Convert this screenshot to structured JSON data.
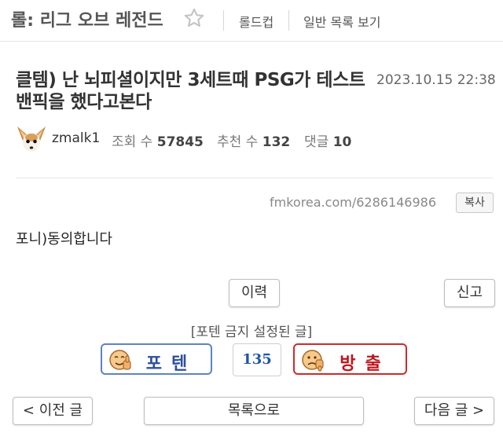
{
  "header": {
    "board_title": "롤: 리그 오브 레전드",
    "links": [
      "롤드컵",
      "일반 목록 보기"
    ]
  },
  "post": {
    "title": "클템) 난 뇌피셜이지만 3세트때 PSG가 테스트 밴픽을 했다고본다",
    "date": "2023.10.15 22:38",
    "author": "zmalk1",
    "views_label": "조회 수",
    "views": "57845",
    "recommend_label": "추천 수",
    "recommend": "132",
    "comments_label": "댓글",
    "comments": "10",
    "url": "fmkorea.com/6286146986",
    "copy_label": "복사",
    "body": "포니)동의합니다"
  },
  "actions": {
    "history": "이력",
    "report": "신고",
    "notice": "[포텐 금지 설정된 글]",
    "vote_up": "포텐",
    "vote_count": "135",
    "vote_down": "방출"
  },
  "nav": {
    "prev": "< 이전 글",
    "list": "목록으로",
    "next": "다음 글 >"
  }
}
